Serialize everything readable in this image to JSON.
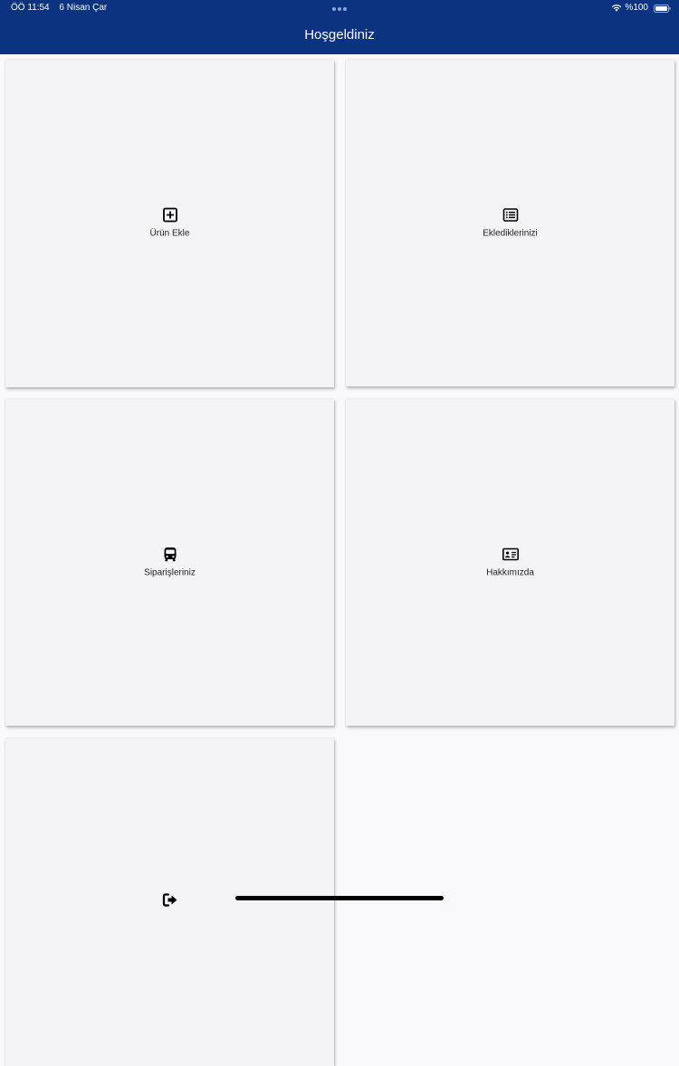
{
  "status_bar": {
    "time": "ÖÖ 11:54",
    "date": "6 Nisan Çar",
    "battery": "%100",
    "icons": [
      "wifi-icon",
      "battery-icon"
    ]
  },
  "header": {
    "title": "Hoşgeldiniz",
    "background_color": "#0b3381"
  },
  "menu": {
    "items": [
      {
        "label": "Ürün Ekle",
        "icon": "plus-square-icon"
      },
      {
        "label": "Eklediklerinizi",
        "icon": "list-icon"
      },
      {
        "label": "Siparişleriniz",
        "icon": "bus-icon"
      },
      {
        "label": "Hakkımızda",
        "icon": "id-card-icon"
      },
      {
        "label": "",
        "icon": "sign-out-icon"
      }
    ]
  }
}
